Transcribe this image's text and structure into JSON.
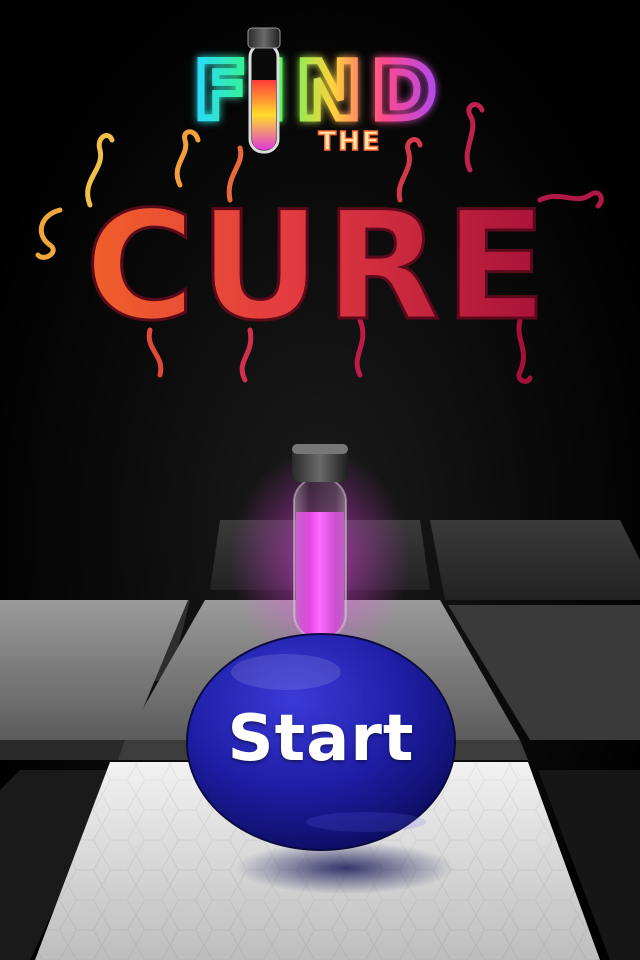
{
  "title": {
    "line1": "FIND",
    "line2": "THE",
    "line3": "CURE"
  },
  "start_button": {
    "label": "Start"
  },
  "colors": {
    "background": "#000000",
    "flask_blue": "#1a1a8c",
    "potion_magenta": "#e040e0",
    "cure_orange": "#e4502a",
    "cure_crimson": "#b8123a",
    "tile_gray": "#d8d8d8"
  },
  "icons": [
    "test-tube-icon",
    "round-flask-icon"
  ]
}
